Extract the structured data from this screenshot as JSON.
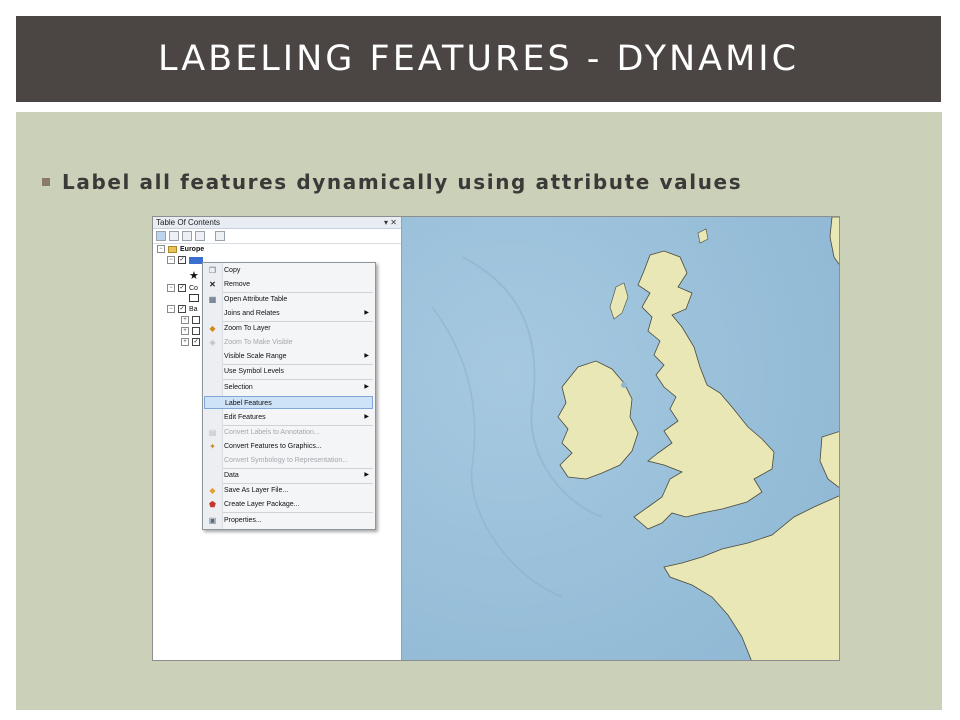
{
  "slide": {
    "title": "LABELING FEATURES - DYNAMIC",
    "bullet": "Label all features dynamically using attribute values"
  },
  "toc": {
    "title": "Table Of Contents",
    "window_controls": "▾ ✕",
    "tree": {
      "group": "Europe",
      "row_labels": [
        "Co",
        "Ba"
      ]
    }
  },
  "context_menu": {
    "items": [
      {
        "label": "Copy",
        "icon": "copy-icon",
        "enabled": true
      },
      {
        "label": "Remove",
        "icon": "remove-icon",
        "enabled": true
      },
      {
        "label": "Open Attribute Table",
        "icon": "table-icon",
        "enabled": true
      },
      {
        "label": "Joins and Relates",
        "icon": "",
        "enabled": true,
        "submenu": true
      },
      {
        "label": "Zoom To Layer",
        "icon": "zoom-layer-icon",
        "enabled": true
      },
      {
        "label": "Zoom To Make Visible",
        "icon": "zoom-visible-icon",
        "enabled": false
      },
      {
        "label": "Visible Scale Range",
        "icon": "",
        "enabled": true,
        "submenu": true
      },
      {
        "label": "Use Symbol Levels",
        "icon": "",
        "enabled": true
      },
      {
        "label": "Selection",
        "icon": "",
        "enabled": true,
        "submenu": true
      },
      {
        "label": "Label Features",
        "icon": "",
        "enabled": true,
        "highlighted": true
      },
      {
        "label": "Edit Features",
        "icon": "",
        "enabled": true,
        "submenu": true
      },
      {
        "label": "Convert Labels to Annotation...",
        "icon": "convert-labels-icon",
        "enabled": false
      },
      {
        "label": "Convert Features to Graphics...",
        "icon": "convert-graphics-icon",
        "enabled": true
      },
      {
        "label": "Convert Symbology to Representation...",
        "icon": "",
        "enabled": false
      },
      {
        "label": "Data",
        "icon": "",
        "enabled": true,
        "submenu": true
      },
      {
        "label": "Save As Layer File...",
        "icon": "layer-file-icon",
        "enabled": true
      },
      {
        "label": "Create Layer Package...",
        "icon": "layer-package-icon",
        "enabled": true
      },
      {
        "label": "Properties...",
        "icon": "properties-icon",
        "enabled": true
      }
    ]
  },
  "colors": {
    "title_bar": "#4b4543",
    "content_bg": "#cbd1b9",
    "sea": "#9fc4dc",
    "land": "#e9e7b6",
    "menu_highlight": "#cfe3f8"
  }
}
